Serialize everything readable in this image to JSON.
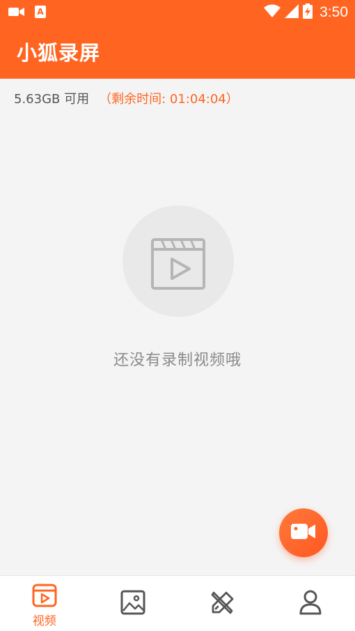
{
  "status_bar": {
    "time": "3:50",
    "left_icons": [
      "video-camera-icon",
      "a-badge-icon"
    ],
    "right_icons": [
      "wifi-icon",
      "cellular-signal-icon",
      "battery-charging-icon"
    ]
  },
  "app_bar": {
    "title": "小狐录屏"
  },
  "storage": {
    "available": "5.63GB 可用",
    "remaining": "（剩余时间: 01:04:04）"
  },
  "empty_state": {
    "icon": "video-clapper-icon",
    "message": "还没有录制视频哦"
  },
  "fab": {
    "icon": "record-video-icon"
  },
  "bottom_nav": {
    "items": [
      {
        "id": "videos",
        "label": "视频",
        "icon": "video-play-icon",
        "active": true
      },
      {
        "id": "screenshots",
        "label": "",
        "icon": "image-icon",
        "active": false
      },
      {
        "id": "tools",
        "label": "",
        "icon": "tools-icon",
        "active": false
      },
      {
        "id": "profile",
        "label": "",
        "icon": "user-icon",
        "active": false
      }
    ]
  },
  "colors": {
    "brand": "#ff6521",
    "background": "#f4f4f4",
    "nav_inactive": "#555555"
  }
}
